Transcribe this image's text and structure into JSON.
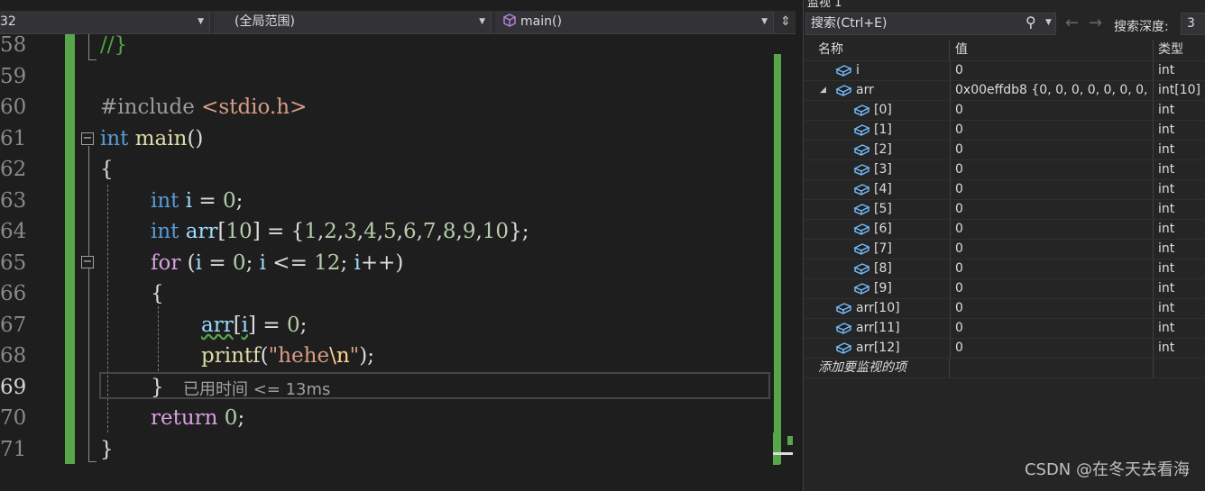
{
  "nav": {
    "project": "32",
    "scope": "(全局范围)",
    "function": "main()"
  },
  "editor": {
    "line_numbers": [
      "58",
      "59",
      "60",
      "61",
      "62",
      "63",
      "64",
      "65",
      "66",
      "67",
      "68",
      "69",
      "70",
      "71"
    ],
    "perf_tip": "已用时间 <= 13ms"
  },
  "watch": {
    "title": "监视 1",
    "search_placeholder": "搜索(Ctrl+E)",
    "depth_label": "搜索深度:",
    "depth_value": "3",
    "headers": {
      "name": "名称",
      "value": "值",
      "type": "类型"
    },
    "rows": [
      {
        "name": "i",
        "value": "0",
        "type": "int"
      },
      {
        "name": "arr",
        "value": "0x00effdb8 {0, 0, 0, 0, 0, 0, 0, 0, 0...",
        "type": "int[10]"
      },
      {
        "name": "[0]",
        "value": "0",
        "type": "int"
      },
      {
        "name": "[1]",
        "value": "0",
        "type": "int"
      },
      {
        "name": "[2]",
        "value": "0",
        "type": "int"
      },
      {
        "name": "[3]",
        "value": "0",
        "type": "int"
      },
      {
        "name": "[4]",
        "value": "0",
        "type": "int"
      },
      {
        "name": "[5]",
        "value": "0",
        "type": "int"
      },
      {
        "name": "[6]",
        "value": "0",
        "type": "int"
      },
      {
        "name": "[7]",
        "value": "0",
        "type": "int"
      },
      {
        "name": "[8]",
        "value": "0",
        "type": "int"
      },
      {
        "name": "[9]",
        "value": "0",
        "type": "int"
      },
      {
        "name": "arr[10]",
        "value": "0",
        "type": "int"
      },
      {
        "name": "arr[11]",
        "value": "0",
        "type": "int"
      },
      {
        "name": "arr[12]",
        "value": "0",
        "type": "int"
      }
    ],
    "add_item": "添加要监视的项"
  },
  "watermark": "CSDN @在冬天去看海"
}
